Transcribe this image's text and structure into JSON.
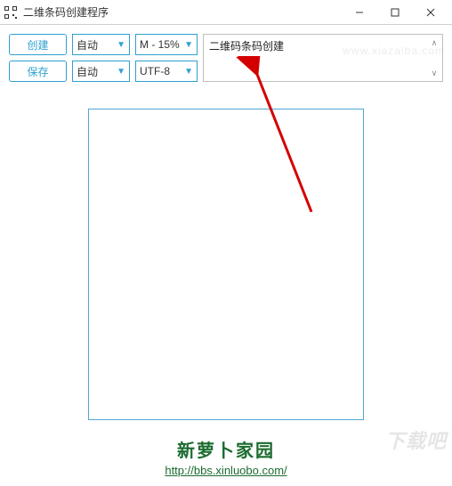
{
  "window": {
    "title": "二维条码创建程序"
  },
  "toolbar": {
    "create_label": "创建",
    "save_label": "保存",
    "dropdown1_row1": "自动",
    "dropdown2_row1": "M - 15%",
    "dropdown1_row2": "自动",
    "dropdown2_row2": "UTF-8"
  },
  "input": {
    "text_value": "二维码条码创建"
  },
  "footer": {
    "site_name": "新萝卜家园",
    "url": "http://bbs.xinluobo.com/"
  },
  "watermark": {
    "main": "下载吧",
    "small": "www.xiazaiba.com"
  }
}
